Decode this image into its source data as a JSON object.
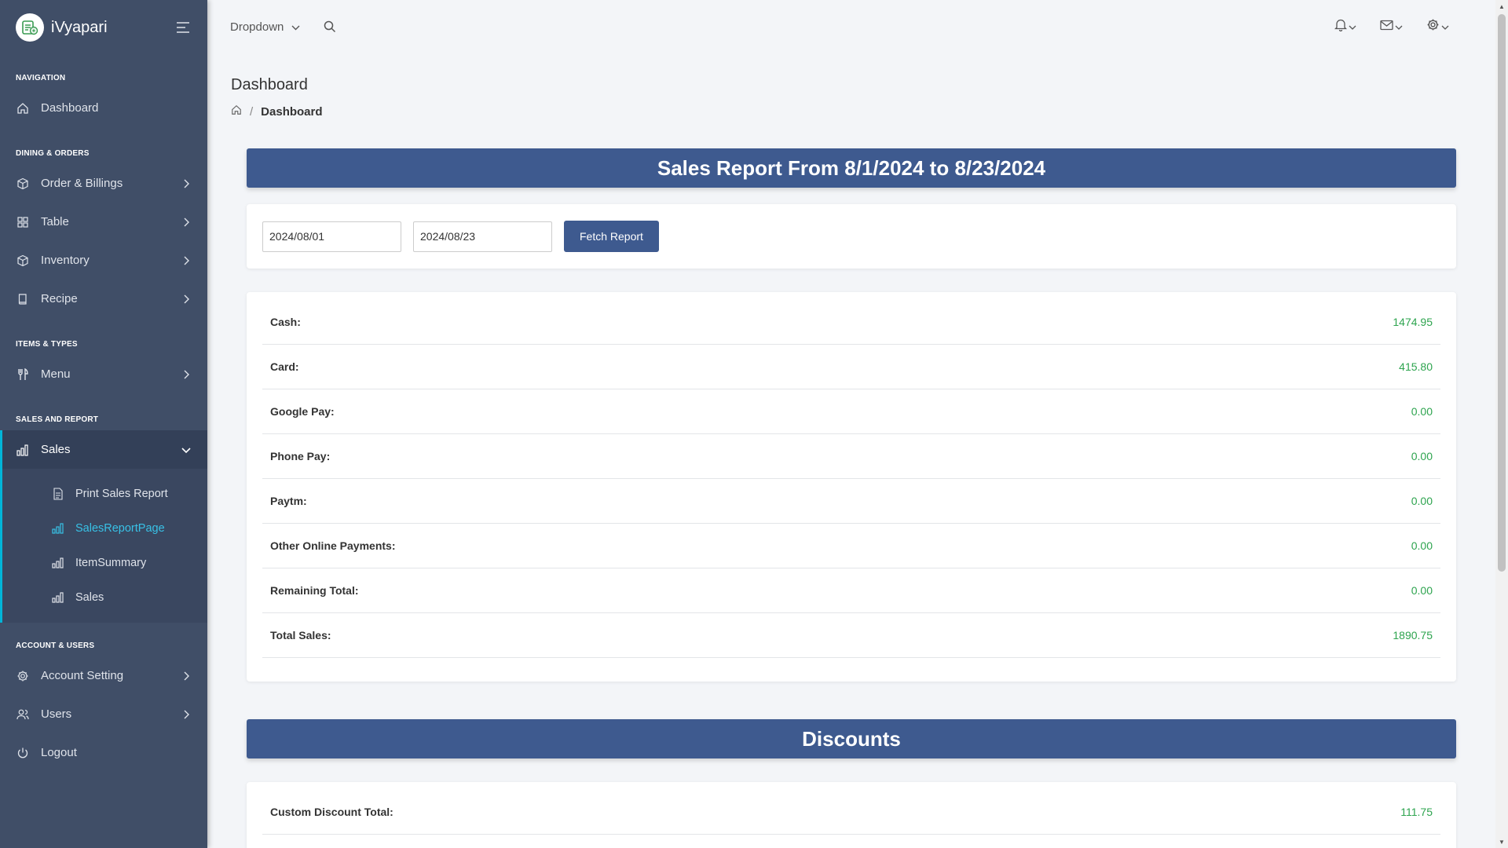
{
  "app": {
    "name": "iVyapari"
  },
  "colors": {
    "sidebar_bg": "#404e67",
    "accent": "#00b5d8",
    "header_blue": "#3e5a8f",
    "value_green": "#2ea44f"
  },
  "sidebar": {
    "sections": {
      "navigation": "NAVIGATION",
      "dining": "DINING & ORDERS",
      "items": "ITEMS & TYPES",
      "sales": "SALES AND REPORT",
      "account": "ACCOUNT & USERS"
    },
    "items": {
      "dashboard": "Dashboard",
      "orders": "Order & Billings",
      "table": "Table",
      "inventory": "Inventory",
      "recipe": "Recipe",
      "menu": "Menu",
      "sales": "Sales",
      "account_setting": "Account Setting",
      "users": "Users",
      "logout": "Logout"
    },
    "sales_submenu": [
      "Print Sales Report",
      "SalesReportPage",
      "ItemSummary",
      "Sales"
    ]
  },
  "topbar": {
    "dropdown_label": "Dropdown"
  },
  "page": {
    "title": "Dashboard",
    "breadcrumb": "Dashboard"
  },
  "report": {
    "header": "Sales Report From 8/1/2024 to 8/23/2024",
    "start_date": "2024/08/01",
    "end_date": "2024/08/23",
    "fetch_label": "Fetch Report",
    "rows": [
      {
        "label": "Cash:",
        "value": "1474.95"
      },
      {
        "label": "Card:",
        "value": "415.80"
      },
      {
        "label": "Google Pay:",
        "value": "0.00"
      },
      {
        "label": "Phone Pay:",
        "value": "0.00"
      },
      {
        "label": "Paytm:",
        "value": "0.00"
      },
      {
        "label": "Other Online Payments:",
        "value": "0.00"
      },
      {
        "label": "Remaining Total:",
        "value": "0.00"
      },
      {
        "label": "Total Sales:",
        "value": "1890.75"
      }
    ]
  },
  "discounts": {
    "header": "Discounts",
    "rows": [
      {
        "label": "Custom Discount Total:",
        "value": "111.75"
      }
    ]
  }
}
